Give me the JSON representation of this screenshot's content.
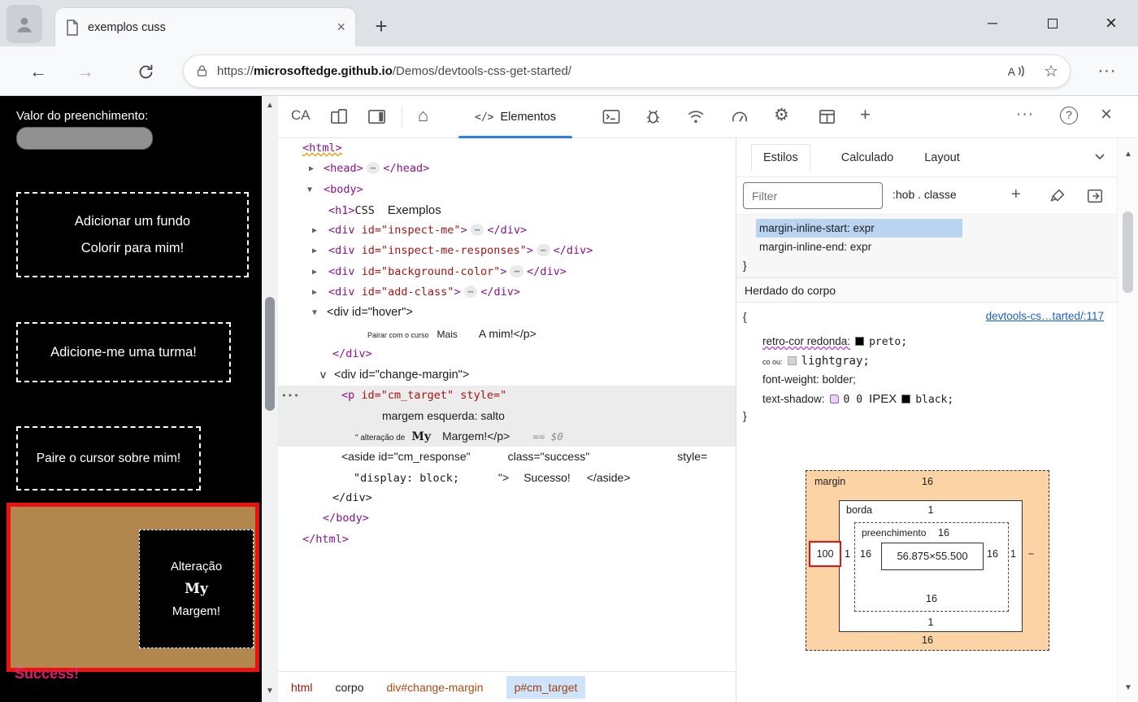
{
  "colors": {
    "accent_blue": "#2b7de9",
    "selection_blue": "#b9d4f1",
    "tag_purple": "#8a1290",
    "attr_maroon": "#a31515",
    "box_model_margin_fill": "#fbd3a4",
    "highlight_red": "#ee1111",
    "page_tan": "#b2874e",
    "success_pink": "#dc1c6e",
    "link_blue": "#1a5fc8"
  },
  "icons": {
    "expand": "▶",
    "collapse": "▼",
    "node_more": "⋯",
    "dots_three": "•••",
    "more_menu": "···",
    "plus": "+",
    "close": "×",
    "minimize": "─",
    "help": "?",
    "back": "←",
    "forward": "→",
    "star": "☆",
    "home": "⌂",
    "gear": "⚙",
    "code": "</>",
    "scroll_up": "▲",
    "scroll_down": "▼"
  },
  "browser": {
    "tab_title": "exemplos cuss",
    "url_scheme": "https://",
    "url_domain": "microsoftedge.github.io",
    "url_path": "/Demos/devtools-css-get-started/"
  },
  "page": {
    "padding_label": "Valor do preenchimento:",
    "button_background_line1": "Adicionar um fundo",
    "button_background_line2": "Colorir para mim!",
    "button_class": "Adicione-me uma turma!",
    "button_hover": "Paire o cursor sobre mim!",
    "margin_demo": {
      "line1": "Alteração",
      "line2": "My",
      "line3": "Margem!"
    },
    "success_text": "Success!"
  },
  "devtools": {
    "toolbar": {
      "inspect_label": "CA",
      "elements_label": "Elementos"
    },
    "dom": {
      "html_open": "<html>",
      "head": {
        "open": "<head>",
        "close": "</head>"
      },
      "body_open": "<body>",
      "h1": {
        "tag": "<h1>",
        "text": "CSS",
        "text2": "Exemplos"
      },
      "divs": [
        {
          "open": "<div",
          "attr": " id=\"inspect-me\"",
          "gt": ">",
          "close": "</div>"
        },
        {
          "open": "<div",
          "attr": " id=\"inspect-me-responses\"",
          "gt": ">",
          "close": "</div>"
        },
        {
          "open": "<div",
          "attr": " id=\"background-color\"",
          "gt": ">",
          "close": "</div>"
        },
        {
          "open": "<div",
          "attr": " id=\"add-class\"",
          "gt": ">",
          "close": "</div>"
        }
      ],
      "hover_open": "<div id=\"hover\">",
      "hover_p": {
        "small": "Pairar com o curso",
        "mid": "Mais",
        "rest": "A mim!</p>"
      },
      "hover_close": "</div>",
      "cm_v": "v",
      "cm_open": "<div id=\"change-margin\">",
      "p_open_tag": "<p",
      "p_open_attr": " id=\"cm_target\" style=\"",
      "p_style": "margem esquerda: salto",
      "p_close_small": "\" alteração de",
      "p_close_my": "My",
      "p_close_rest": "Margem!</p>",
      "dollar_hint": "== $0",
      "aside": {
        "a1": "<aside id=\"cm_response\"",
        "a2": "class=\"success\"",
        "a3": "style=",
        "b1": "\"display: block;",
        "b2": "\">",
        "b3": "Sucesso!",
        "b4": "</aside>"
      },
      "cm_close": "</div>",
      "body_close": "</body>",
      "html_close": "</html>"
    },
    "breadcrumbs": [
      "html",
      "corpo",
      "div#change-margin",
      "p#cm_target"
    ],
    "styles": {
      "tabs": [
        "Estilos",
        "Calculado",
        "Layout"
      ],
      "filter_placeholder": "Filter",
      "pseudo_label": ":hob . classe",
      "scrolled_props": [
        "margin-inline-start: expr",
        "margin-inline-end: expr"
      ],
      "brace_open": "{",
      "brace_close": "}",
      "inherited_header": "Herdado do corpo",
      "source_link": "devtools-cs…tarted/:117",
      "prop_bg_name": "retro-cor redonda:",
      "prop_bg_value": "preto;",
      "prop_color_name": "co ou:",
      "prop_color_value": "lightgray;",
      "prop_weight": "font-weight: bolder;",
      "prop_shadow_name": "text-shadow:",
      "prop_shadow_val1": "0 0",
      "prop_shadow_val2": "IPEX",
      "prop_shadow_val3": "black;"
    },
    "box_model": {
      "margin_label": "margin",
      "border_label": "borda",
      "padding_label": "preenchimento",
      "content": "56.875×55.500",
      "margin_top": "16",
      "margin_right": "−",
      "margin_bottom": "16",
      "margin_left": "100",
      "border_top": "1",
      "border_right": "1",
      "border_bottom": "1",
      "border_left": "1",
      "padding_top": "16",
      "padding_right": "16",
      "padding_bottom": "16",
      "padding_left": "16"
    }
  }
}
